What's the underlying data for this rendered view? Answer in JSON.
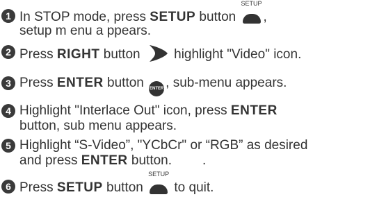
{
  "steps": [
    {
      "number": "1",
      "line1": {
        "text_before": "In STOP mode, press ",
        "bold": "SETUP",
        "text_after": " button "
      },
      "setup_icon_caption": "SETUP",
      "line1_tail": ",",
      "line2": "setup m enu a ppears."
    },
    {
      "number": "2",
      "text_before": "Press ",
      "bold": "RIGHT",
      "text_after": " button ",
      "text_end": " highlight \"Video\" icon."
    },
    {
      "number": "3",
      "text_before": "Press ",
      "bold": "ENTER",
      "text_after": " button ",
      "enter_icon_caption": "ENTER",
      "text_end": ", sub-menu appears."
    },
    {
      "number": "4",
      "line1": {
        "text_before": "Highlight \"Interlace Out\" icon, press ",
        "bold": "ENTER"
      },
      "line2": "button, sub menu appears."
    },
    {
      "number": "5",
      "line1": "Highlight “S-Video”, \"YCbCr\" or “RGB” as desired",
      "line2": {
        "text_before": "and press ",
        "bold": "ENTER",
        "text_after": " button.",
        "tail": "."
      }
    },
    {
      "number": "6",
      "text_before": "Press ",
      "bold": "SETUP",
      "text_after": " button ",
      "setup_icon_caption": "SETUP",
      "text_end": " to quit."
    }
  ],
  "colors": {
    "text": "#333333",
    "badge": "#3a3a3a",
    "icon": "#333333"
  }
}
